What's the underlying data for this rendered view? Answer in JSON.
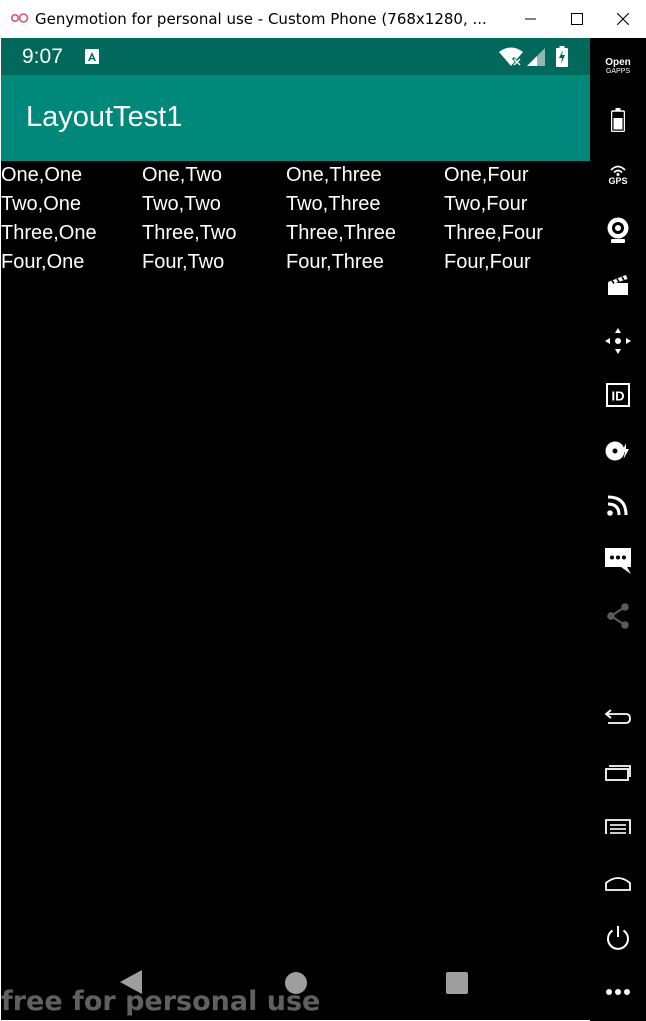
{
  "window": {
    "title": "Genymotion for personal use - Custom Phone (768x1280, ..."
  },
  "status_bar": {
    "time": "9:07"
  },
  "app": {
    "title": "LayoutTest1"
  },
  "table": {
    "rows": [
      [
        "One,One",
        "One,Two",
        "One,Three",
        "One,Four"
      ],
      [
        "Two,One",
        "Two,Two",
        "Two,Three",
        "Two,Four"
      ],
      [
        "Three,One",
        "Three,Two",
        "Three,Three",
        "Three,Four"
      ],
      [
        "Four,One",
        "Four,Two",
        "Four,Three",
        "Four,Four"
      ]
    ]
  },
  "sidebar": {
    "gapps_line1": "Open",
    "gapps_line2": "GAPPS",
    "gps_label": "GPS",
    "id_label": "ID"
  },
  "watermark": "free for personal use",
  "colors": {
    "status_bar": "#00695c",
    "app_bar": "#00897b",
    "screen_bg": "#000000"
  }
}
